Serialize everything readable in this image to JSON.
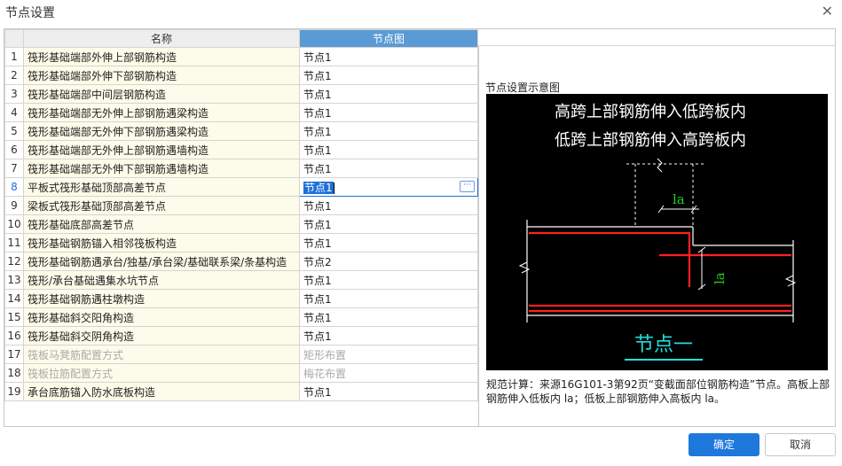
{
  "window": {
    "title": "节点设置"
  },
  "table": {
    "headers": [
      "名称",
      "节点图"
    ],
    "rows": [
      {
        "num": "1",
        "name": "筏形基础端部外伸上部钢筋构造",
        "value": "节点1"
      },
      {
        "num": "2",
        "name": "筏形基础端部外伸下部钢筋构造",
        "value": "节点1"
      },
      {
        "num": "3",
        "name": "筏形基础端部中间层钢筋构造",
        "value": "节点1"
      },
      {
        "num": "4",
        "name": "筏形基础端部无外伸上部钢筋遇梁构造",
        "value": "节点1"
      },
      {
        "num": "5",
        "name": "筏形基础端部无外伸下部钢筋遇梁构造",
        "value": "节点1"
      },
      {
        "num": "6",
        "name": "筏形基础端部无外伸上部钢筋遇墙构造",
        "value": "节点1"
      },
      {
        "num": "7",
        "name": "筏形基础端部无外伸下部钢筋遇墙构造",
        "value": "节点1"
      },
      {
        "num": "8",
        "name": "平板式筏形基础顶部高差节点",
        "value": "节点1"
      },
      {
        "num": "9",
        "name": "梁板式筏形基础顶部高差节点",
        "value": "节点1"
      },
      {
        "num": "10",
        "name": "筏形基础底部高差节点",
        "value": "节点1"
      },
      {
        "num": "11",
        "name": "筏形基础钢筋锚入相邻筏板构造",
        "value": "节点1"
      },
      {
        "num": "12",
        "name": "筏形基础钢筋遇承台/独基/承台梁/基础联系梁/条基构造",
        "value": "节点2"
      },
      {
        "num": "13",
        "name": "筏形/承台基础遇集水坑节点",
        "value": "节点1"
      },
      {
        "num": "14",
        "name": "筏形基础钢筋遇柱墩构造",
        "value": "节点1"
      },
      {
        "num": "15",
        "name": "筏形基础斜交阳角构造",
        "value": "节点1"
      },
      {
        "num": "16",
        "name": "筏形基础斜交阴角构造",
        "value": "节点1"
      },
      {
        "num": "17",
        "name": "筏板马凳筋配置方式",
        "value": "矩形布置"
      },
      {
        "num": "18",
        "name": "筏板拉筋配置方式",
        "value": "梅花布置"
      },
      {
        "num": "19",
        "name": "承台底筋锚入防水底板构造",
        "value": "节点1"
      }
    ],
    "selected_row": 8,
    "disabled_rows": [
      17,
      18
    ],
    "ellipsis": "···"
  },
  "preview": {
    "title": "节点设置示意图",
    "line1": "高跨上部钢筋伸入低跨板内",
    "line2": "低跨上部钢筋伸入高跨板内",
    "dim_h": "la",
    "dim_v": "la",
    "node_label": "节点一"
  },
  "description": "规范计算：来源16G101-3第92页“变截面部位钢筋构造”节点。高板上部钢筋伸入低板内 la；低板上部钢筋伸入高板内 la。",
  "buttons": {
    "ok": "确定",
    "cancel": "取消"
  },
  "colors": {
    "accent": "#1e78dc",
    "header_selected": "#5b9bd5",
    "name_cell_bg": "#fdfbe9",
    "rebar": "#ff2020",
    "dimension": "#22cc22",
    "node_label": "#22dddd"
  }
}
